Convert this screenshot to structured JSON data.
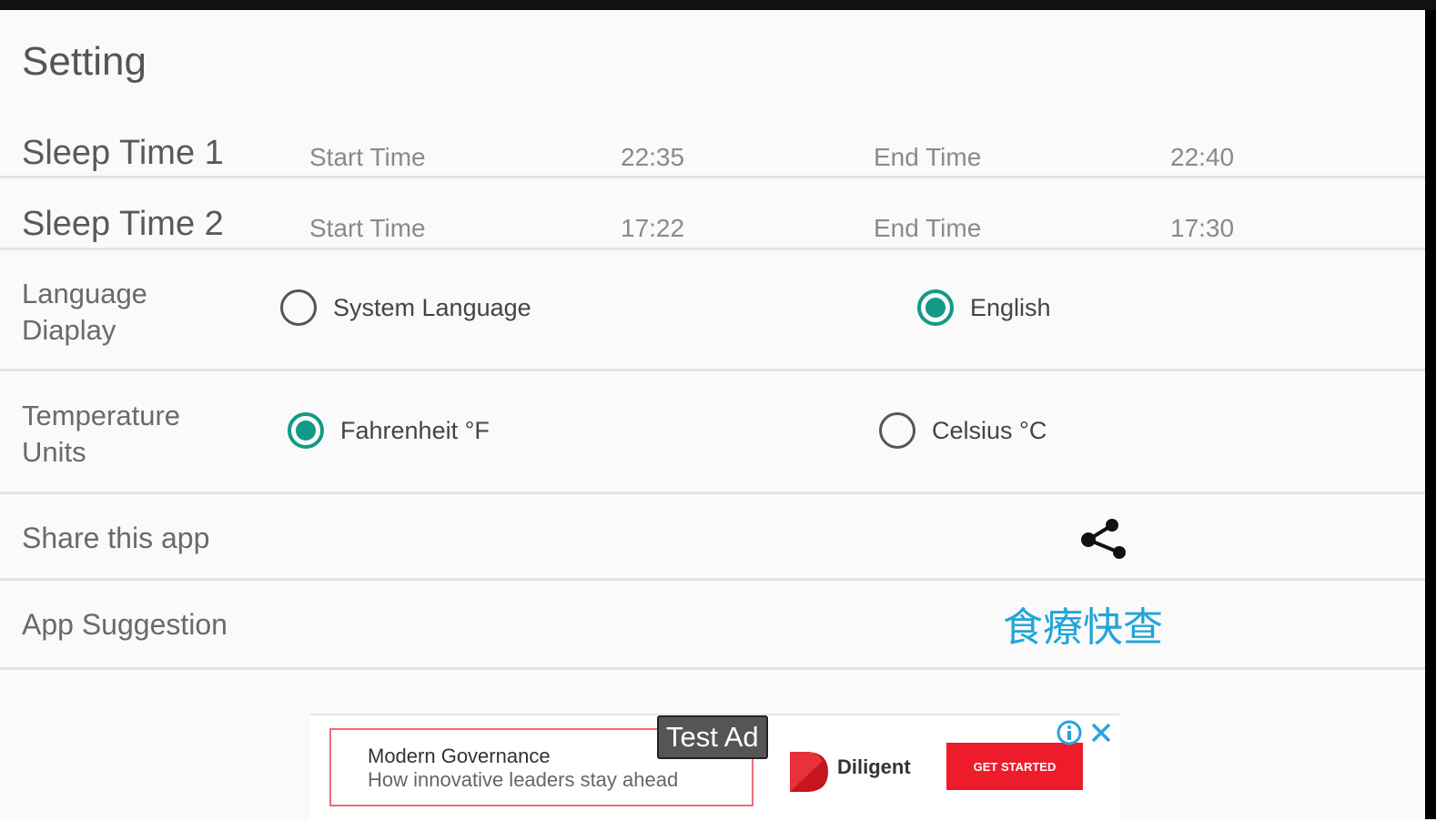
{
  "page": {
    "title": "Setting"
  },
  "sleep_times": [
    {
      "label": "Sleep Time 1",
      "start_label": "Start Time",
      "start_value": "22:35",
      "end_label": "End Time",
      "end_value": "22:40"
    },
    {
      "label": "Sleep Time 2",
      "start_label": "Start Time",
      "start_value": "17:22",
      "end_label": "End Time",
      "end_value": "17:30"
    }
  ],
  "language": {
    "label_line1": "Language",
    "label_line2": "Diaplay",
    "options": [
      {
        "label": "System Language",
        "checked": false
      },
      {
        "label": "English",
        "checked": true
      }
    ]
  },
  "temperature": {
    "label_line1": "Temperature",
    "label_line2": "Units",
    "options": [
      {
        "label": "Fahrenheit °F",
        "checked": true
      },
      {
        "label": "Celsius °C",
        "checked": false
      }
    ]
  },
  "share": {
    "label": "Share this app",
    "icon": "share-icon"
  },
  "suggestion": {
    "label": "App Suggestion",
    "app_name": "食療快查",
    "color": "#21a5d8"
  },
  "ad": {
    "badge": "Test Ad",
    "title": "Modern Governance",
    "subtitle": "How innovative leaders stay ahead",
    "brand": "Diligent",
    "cta": "GET STARTED",
    "cta_color": "#ee1b2a"
  },
  "colors": {
    "accent": "#139a86",
    "background": "#fafafa"
  }
}
